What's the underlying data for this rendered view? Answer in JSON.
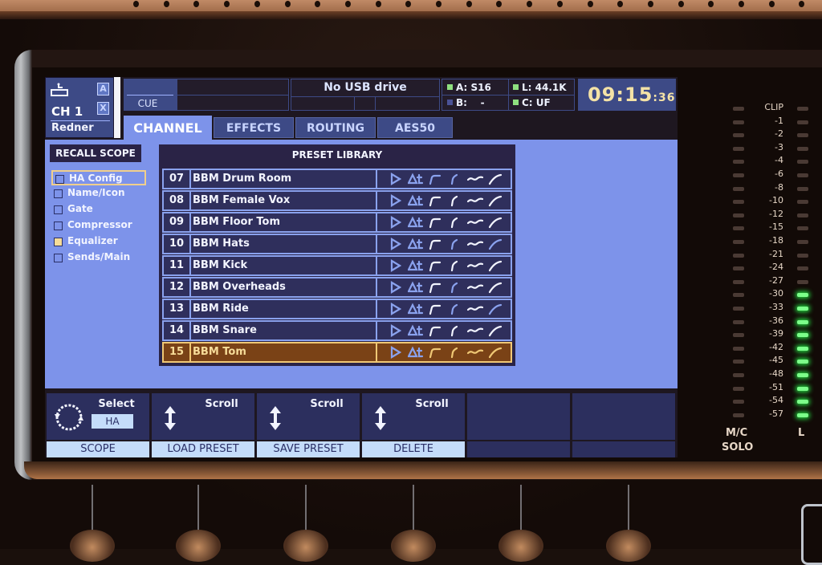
{
  "header": {
    "channel": {
      "name": "CH 1",
      "user_name": "Redner",
      "badge_a": "A",
      "badge_x": "X"
    },
    "cue_label": "CUE",
    "usb_status": "No USB drive",
    "status": [
      {
        "label": "A:",
        "value": "S16",
        "indicator": "#8ee07f"
      },
      {
        "label": "L:",
        "value": "44.1K",
        "indicator": "#8ee07f"
      },
      {
        "label": "B:",
        "value": "-",
        "indicator": "#4a5296"
      },
      {
        "label": "C:",
        "value": "UF",
        "indicator": "#8ee07f"
      }
    ],
    "clock": {
      "hm": "09:15",
      "sec": ":36"
    }
  },
  "tabs": [
    {
      "label": "CHANNEL",
      "active": true
    },
    {
      "label": "EFFECTS",
      "active": false
    },
    {
      "label": "ROUTING",
      "active": false
    },
    {
      "label": "AES50",
      "active": false
    }
  ],
  "recall_scope": {
    "title": "RECALL SCOPE",
    "items": [
      {
        "label": "HA Config",
        "checked": false,
        "focused": true
      },
      {
        "label": "Name/Icon",
        "checked": false,
        "focused": false
      },
      {
        "label": "Gate",
        "checked": false,
        "focused": false
      },
      {
        "label": "Compressor",
        "checked": false,
        "focused": false
      },
      {
        "label": "Equalizer",
        "checked": true,
        "focused": false
      },
      {
        "label": "Sends/Main",
        "checked": false,
        "focused": false
      }
    ]
  },
  "preset_library": {
    "title": "PRESET LIBRARY",
    "icon_names": [
      "preamp-icon",
      "delay-icon",
      "gate-icon",
      "compressor-icon",
      "eq-icon",
      "sends-icon"
    ],
    "rows": [
      {
        "num": "07",
        "name": "BBM Drum Room",
        "flags": [
          1,
          1,
          0,
          0,
          1,
          1
        ],
        "selected": false
      },
      {
        "num": "08",
        "name": "BBM Female Vox",
        "flags": [
          1,
          1,
          1,
          1,
          1,
          1
        ],
        "selected": false
      },
      {
        "num": "09",
        "name": "BBM Floor Tom",
        "flags": [
          1,
          1,
          1,
          1,
          1,
          1
        ],
        "selected": false
      },
      {
        "num": "10",
        "name": "BBM Hats",
        "flags": [
          1,
          1,
          1,
          0,
          1,
          0
        ],
        "selected": false
      },
      {
        "num": "11",
        "name": "BBM Kick",
        "flags": [
          1,
          1,
          1,
          1,
          1,
          1
        ],
        "selected": false
      },
      {
        "num": "12",
        "name": "BBM Overheads",
        "flags": [
          1,
          1,
          1,
          0,
          1,
          1
        ],
        "selected": false
      },
      {
        "num": "13",
        "name": "BBM Ride",
        "flags": [
          1,
          1,
          1,
          0,
          1,
          0
        ],
        "selected": false
      },
      {
        "num": "14",
        "name": "BBM Snare",
        "flags": [
          1,
          1,
          1,
          1,
          1,
          1
        ],
        "selected": false
      },
      {
        "num": "15",
        "name": "BBM Tom",
        "flags": [
          1,
          1,
          1,
          1,
          1,
          1
        ],
        "selected": true
      }
    ]
  },
  "softkeys": [
    {
      "head": "Select",
      "value": "HA",
      "label": "SCOPE",
      "icon": "rotary-icon"
    },
    {
      "head": "Scroll",
      "value": "",
      "label": "LOAD PRESET",
      "icon": "up-down-arrow-icon"
    },
    {
      "head": "Scroll",
      "value": "",
      "label": "SAVE PRESET",
      "icon": "up-down-arrow-icon"
    },
    {
      "head": "Scroll",
      "value": "",
      "label": "DELETE",
      "icon": "up-down-arrow-icon"
    },
    {
      "head": "",
      "value": "",
      "label": "",
      "icon": ""
    },
    {
      "head": "",
      "value": "",
      "label": "",
      "icon": ""
    }
  ],
  "meter": {
    "scale": [
      "CLIP",
      "-1",
      "-2",
      "-3",
      "-4",
      "-6",
      "-8",
      "-10",
      "-12",
      "-15",
      "-18",
      "-21",
      "-24",
      "-27",
      "-30",
      "-33",
      "-36",
      "-39",
      "-42",
      "-45",
      "-48",
      "-51",
      "-54",
      "-57"
    ],
    "left_level_db": -30,
    "label_left_line1": "M/C",
    "label_left_line2": "SOLO",
    "label_right": "L"
  },
  "colors": {
    "screen_bg": "#7d93ea",
    "panel_dark": "#2a2346",
    "selected_row": "#7a4216",
    "selected_accent": "#f0c875",
    "meter_green": "#7cff8a",
    "clock": "#f4e2a6"
  }
}
